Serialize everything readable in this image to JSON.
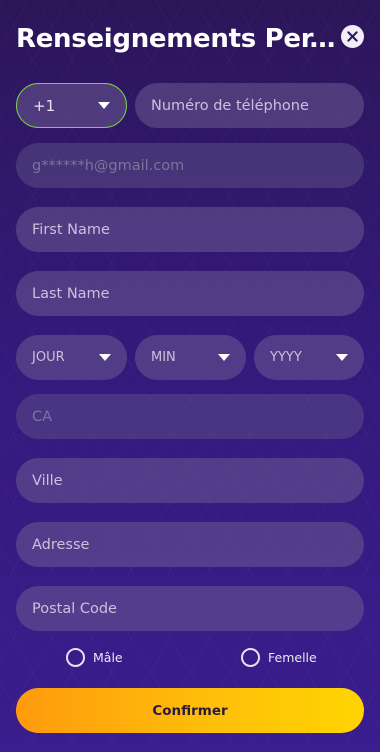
{
  "header": {
    "title": "Renseignements Per..."
  },
  "phone": {
    "country_code": "+1",
    "placeholder": "Numéro de téléphone"
  },
  "email": {
    "value": "g******h@gmail.com"
  },
  "first_name": {
    "placeholder": "First Name"
  },
  "last_name": {
    "placeholder": "Last Name"
  },
  "birth": {
    "day": "JOUR",
    "month": "MIN",
    "year": "YYYY"
  },
  "region": {
    "value": "CA"
  },
  "city": {
    "placeholder": "Ville"
  },
  "address": {
    "placeholder": "Adresse"
  },
  "postal": {
    "placeholder": "Postal Code"
  },
  "gender": {
    "male": "Mâle",
    "female": "Femelle"
  },
  "actions": {
    "confirm": "Confirmer"
  }
}
